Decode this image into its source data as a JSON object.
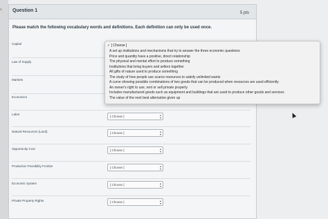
{
  "nav": {
    "back_icon": "chevron-left-icon"
  },
  "question": {
    "title": "Question 1",
    "points": "5 pts",
    "instructions": "Please match the following vocabulary words and definitions. Each definition can only be used once."
  },
  "rows": [
    {
      "term": "Capital",
      "selected": ""
    },
    {
      "term": "Law of Supply",
      "selected": ""
    },
    {
      "term": "Markets",
      "selected": ""
    },
    {
      "term": "Economics",
      "selected": ""
    },
    {
      "term": "Labor",
      "selected": "[ Choose ]"
    },
    {
      "term": "Natural Resources (Land)",
      "selected": "[ Choose ]"
    },
    {
      "term": "Opportunity Cost",
      "selected": "[ Choose ]"
    },
    {
      "term": "Production Possibility Frontier",
      "selected": "[ Choose ]"
    },
    {
      "term": "Economic System",
      "selected": "[ Choose ]"
    },
    {
      "term": "Private Property Rights",
      "selected": "[ Choose ]"
    }
  ],
  "dropdown": {
    "selected_label": "[ Choose ]",
    "options": [
      "A set up institutions and mechanisms that try to answer the three economic questions",
      "Price and quantity have a positive, direct relationship",
      "The physical and mental effort to produce something",
      "Institutions that bring buyers and sellers together",
      "All gifts of nature used to produce something",
      "The study of how people use scarce resources to satisfy unlimited wants",
      "A curve showing possible combinations of two goods that can be produced when resources are used efficiently",
      "An owner's right to use, rent or sell private property",
      "Includes manufactured goods such as equipment and buildings that are used to produce other goods and services",
      "The value of the next best alternative given up"
    ]
  },
  "colors": {
    "text": "#2d3b45",
    "header_bg": "#e3e6e8",
    "page_bg": "#eceeef"
  }
}
